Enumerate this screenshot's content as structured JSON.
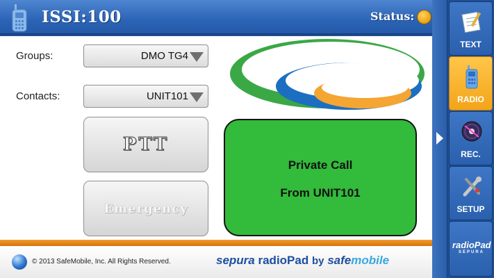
{
  "header": {
    "title": "ISSI:100",
    "status_label": "Status:",
    "status_color": "#f0a81c"
  },
  "form": {
    "groups_label": "Groups:",
    "groups_value": "DMO TG4",
    "contacts_label": "Contacts:",
    "contacts_value": "UNIT101"
  },
  "buttons": {
    "ptt_label": "PTT",
    "emergency_label": "Emergency"
  },
  "call_panel": {
    "line1": "Private Call",
    "line2": "From UNIT101",
    "bg_color": "#33bb3b"
  },
  "footer": {
    "copyright": "© 2013 SafeMobile, Inc. All Rights Reserved.",
    "brand_sepura": "sepura",
    "brand_radiopad": "radioPad",
    "brand_by": "by",
    "brand_safe": "safe",
    "brand_mobile": "mobile"
  },
  "nav": {
    "items": [
      {
        "label": "TEXT",
        "icon": "notepad-icon",
        "active": false
      },
      {
        "label": "RADIO",
        "icon": "radio-icon",
        "active": true
      },
      {
        "label": "REC.",
        "icon": "disc-icon",
        "active": false
      },
      {
        "label": "SETUP",
        "icon": "tools-icon",
        "active": false
      }
    ],
    "logo_big": "radioPad",
    "logo_small": "SEPURA"
  },
  "colors": {
    "accent_blue": "#2c64b6",
    "accent_orange": "#f19c2c",
    "logo_green": "#3aa845",
    "logo_blue": "#1c6fc0",
    "logo_orange": "#f4a532"
  }
}
